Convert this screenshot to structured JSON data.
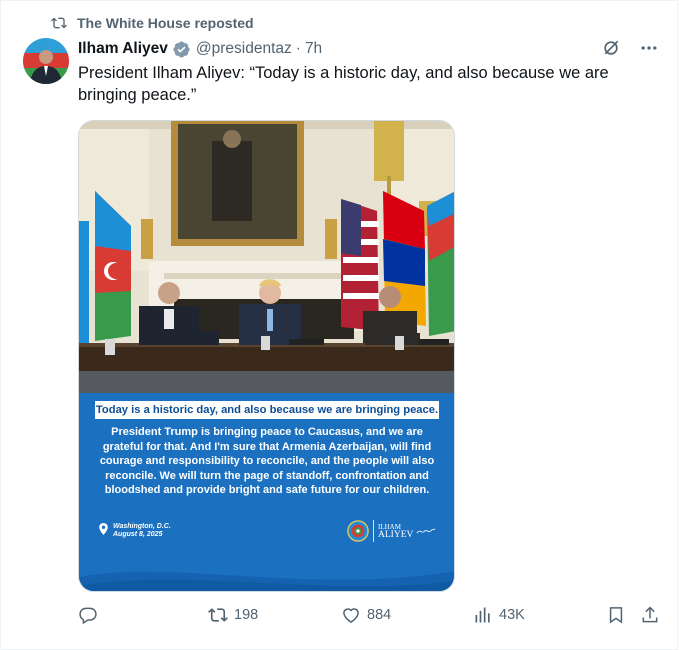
{
  "repost": {
    "label": "The White House reposted",
    "icon": "repost-icon"
  },
  "author": {
    "name": "Ilham Aliyev",
    "handle": "@presidentaz",
    "time": "7h",
    "verified": true
  },
  "tweet": {
    "text": "President Ilham Aliyev: “Today is a historic day, and also because we are bringing peace.”"
  },
  "media": {
    "banner": "Today is a historic day, and also because we are bringing peace.",
    "body": "President Trump is bringing peace to Caucasus, and we are grateful for that. And I'm sure that Armenia Azerbaijan, will find courage and responsibility to reconcile, and the people will also reconcile. We will turn the page of standoff, confrontation and bloodshed and provide bright and safe future for our children.",
    "place": "Washington, D.C.",
    "date": "August 8, 2025",
    "brand_name": "ILHAM",
    "brand_surname": "ALIYEV",
    "brand_colors": {
      "panel": "#1b71c0",
      "banner_text": "#0c4e96"
    }
  },
  "actions": {
    "reply": {
      "icon": "reply-icon",
      "count": ""
    },
    "repost": {
      "icon": "repost-icon",
      "count": "198"
    },
    "like": {
      "icon": "heart-icon",
      "count": "884"
    },
    "views": {
      "icon": "views-icon",
      "count": "43K"
    },
    "bookmark": {
      "icon": "bookmark-icon"
    },
    "share": {
      "icon": "share-icon"
    }
  },
  "colors": {
    "text": "#0f1419",
    "muted": "#536471",
    "verified": "#829aab"
  }
}
